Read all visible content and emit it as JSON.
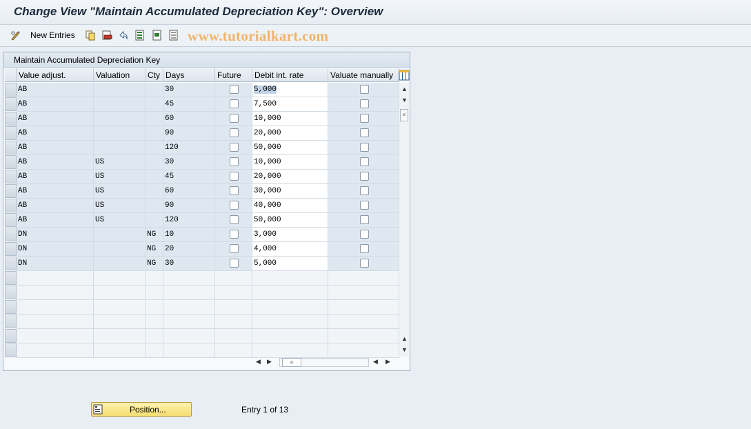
{
  "title": "Change View \"Maintain Accumulated Depreciation Key\": Overview",
  "toolbar": {
    "new_entries_label": "New Entries",
    "watermark": "www.tutorialkart.com"
  },
  "panel": {
    "title": "Maintain Accumulated Depreciation Key"
  },
  "table": {
    "columns": [
      "Value adjust.",
      "Valuation",
      "Cty",
      "Days",
      "Future",
      "Debit int. rate",
      "Valuate manually"
    ],
    "rows": [
      {
        "value_adjust": "AB",
        "valuation": "",
        "cty": "",
        "days": "30",
        "future": false,
        "rate": "5,000",
        "manual": false
      },
      {
        "value_adjust": "AB",
        "valuation": "",
        "cty": "",
        "days": "45",
        "future": false,
        "rate": "7,500",
        "manual": false
      },
      {
        "value_adjust": "AB",
        "valuation": "",
        "cty": "",
        "days": "60",
        "future": false,
        "rate": "10,000",
        "manual": false
      },
      {
        "value_adjust": "AB",
        "valuation": "",
        "cty": "",
        "days": "90",
        "future": false,
        "rate": "20,000",
        "manual": false
      },
      {
        "value_adjust": "AB",
        "valuation": "",
        "cty": "",
        "days": "120",
        "future": false,
        "rate": "50,000",
        "manual": false
      },
      {
        "value_adjust": "AB",
        "valuation": "US",
        "cty": "",
        "days": "30",
        "future": false,
        "rate": "10,000",
        "manual": false
      },
      {
        "value_adjust": "AB",
        "valuation": "US",
        "cty": "",
        "days": "45",
        "future": false,
        "rate": "20,000",
        "manual": false
      },
      {
        "value_adjust": "AB",
        "valuation": "US",
        "cty": "",
        "days": "60",
        "future": false,
        "rate": "30,000",
        "manual": false
      },
      {
        "value_adjust": "AB",
        "valuation": "US",
        "cty": "",
        "days": "90",
        "future": false,
        "rate": "40,000",
        "manual": false
      },
      {
        "value_adjust": "AB",
        "valuation": "US",
        "cty": "",
        "days": "120",
        "future": false,
        "rate": "50,000",
        "manual": false
      },
      {
        "value_adjust": "DN",
        "valuation": "",
        "cty": "NG",
        "days": "10",
        "future": false,
        "rate": "3,000",
        "manual": false
      },
      {
        "value_adjust": "DN",
        "valuation": "",
        "cty": "NG",
        "days": "20",
        "future": false,
        "rate": "4,000",
        "manual": false
      },
      {
        "value_adjust": "DN",
        "valuation": "",
        "cty": "NG",
        "days": "30",
        "future": false,
        "rate": "5,000",
        "manual": false
      }
    ],
    "empty_rows": 6
  },
  "footer": {
    "position_label": "Position...",
    "entry_info": "Entry 1 of 13"
  },
  "colors": {
    "accent_button": "#f4dd70",
    "readonly_cell": "#dfe8f1",
    "watermark": "#f0b36a"
  }
}
